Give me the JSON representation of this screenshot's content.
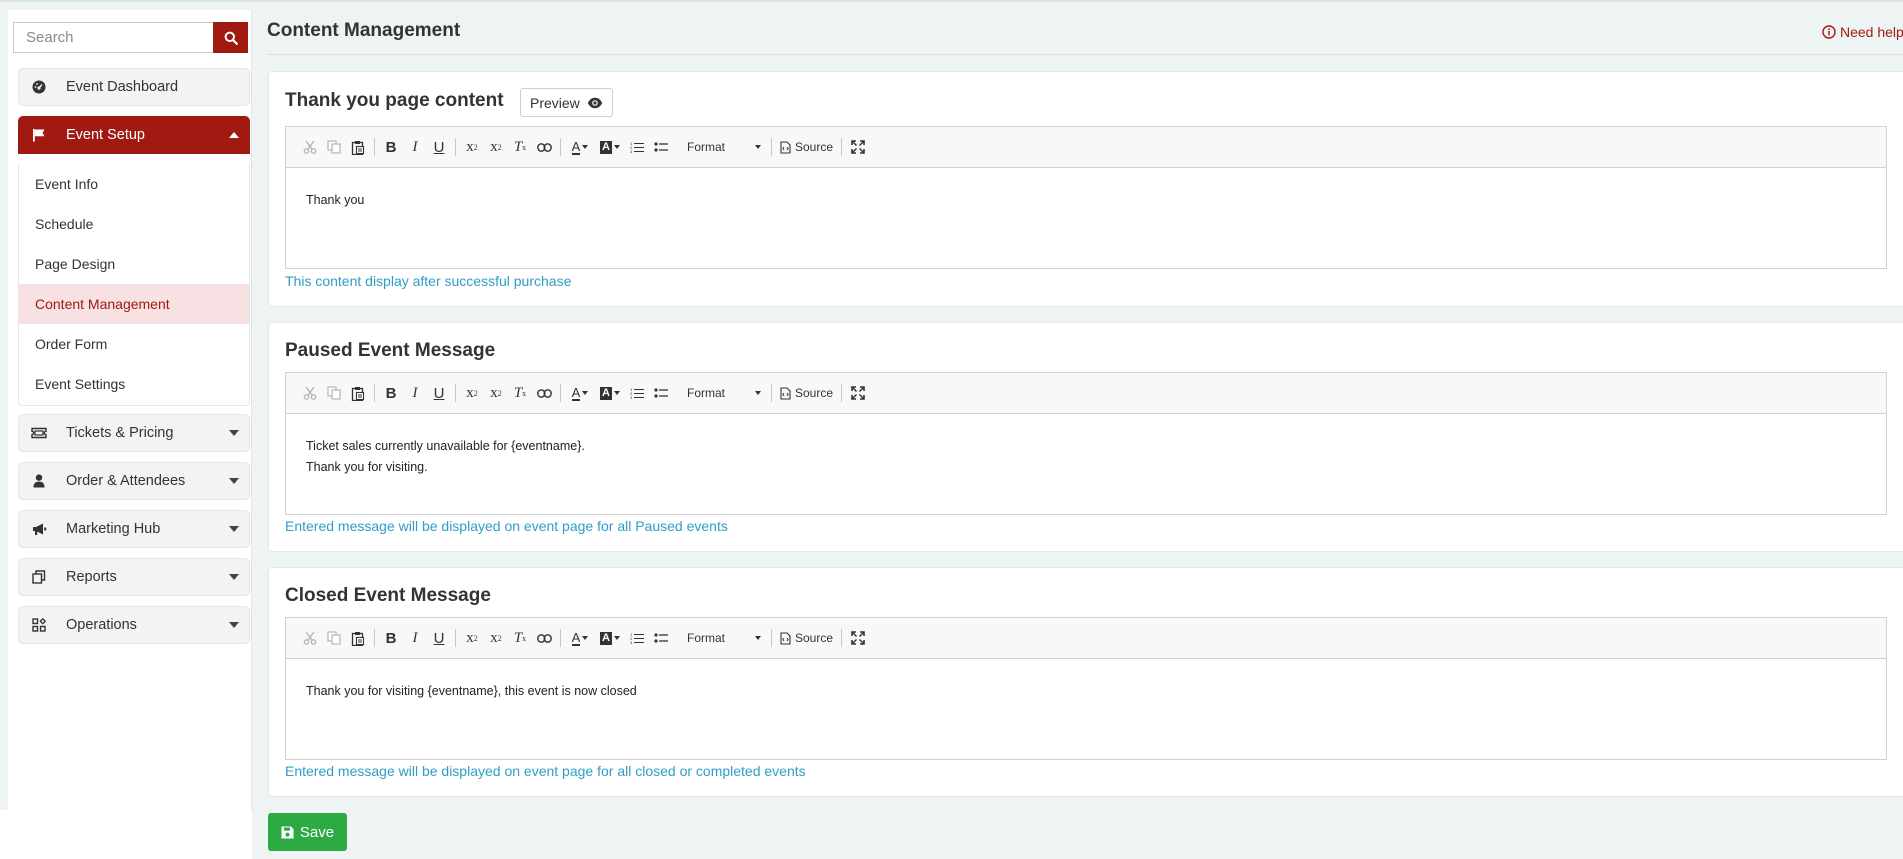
{
  "sidebar": {
    "search_placeholder": "Search",
    "dashboard_label": "Event Dashboard",
    "event_setup_label": "Event Setup",
    "submenu": [
      "Event Info",
      "Schedule",
      "Page Design",
      "Content Management",
      "Order Form",
      "Event Settings"
    ],
    "tickets_label": "Tickets & Pricing",
    "orders_label": "Order & Attendees",
    "marketing_label": "Marketing Hub",
    "reports_label": "Reports",
    "operations_label": "Operations"
  },
  "header": {
    "title": "Content Management",
    "help_label": "Need help"
  },
  "toolbar": {
    "format_label": "Format",
    "source_label": "Source"
  },
  "sections": [
    {
      "title": "Thank you page content",
      "preview_label": "Preview",
      "content": "Thank you",
      "help": "This content display after successful purchase"
    },
    {
      "title": "Paused Event Message",
      "content": "Ticket sales currently unavailable for {eventname}.\nThank you for visiting.",
      "help": "Entered message will be displayed on event page for all Paused events"
    },
    {
      "title": "Closed Event Message",
      "content": "Thank you for visiting {eventname}, this event is now closed",
      "help": "Entered message will be displayed on event page for all closed or completed events"
    }
  ],
  "save_label": "Save",
  "colors": {
    "brand": "#a11a12",
    "active_bg": "#f7e1e2",
    "help_text": "#2f9ec7",
    "save": "#2daa44",
    "page_bg": "#eef4f3"
  }
}
